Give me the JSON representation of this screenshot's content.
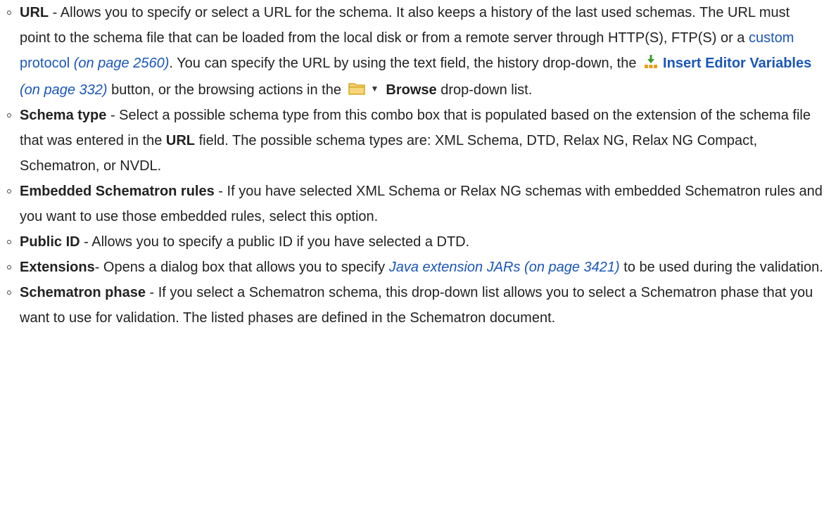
{
  "items": [
    {
      "term": "URL",
      "sep": " - ",
      "text1": "Allows you to specify or select a URL for the schema. It also keeps a history of the last used schemas. The URL must point to the schema file that can be loaded from the local disk or from a remote server through HTTP(S), FTP(S) or a ",
      "link1": "custom protocol",
      "ref1": " (on page 2560)",
      "text2": ". You can specify the URL by using the text field, the history drop-down, the ",
      "link2": "Insert Editor Variables",
      "ref2": " (on page 332)",
      "text3": " button, or the browsing actions in the ",
      "browse": "Browse",
      "text4": " drop-down list."
    },
    {
      "term": "Schema type",
      "sep": " - ",
      "text1": "Select a possible schema type from this combo box that is populated based on the extension of the schema file that was entered in the ",
      "bold2": "URL",
      "text2": " field. The possible schema types are: XML Schema, DTD, Relax NG, Relax NG Compact, Schematron, or NVDL."
    },
    {
      "term": "Embedded Schematron rules",
      "sep": " - ",
      "text1": "If you have selected XML Schema or Relax NG schemas with embedded Schematron rules and you want to use those embedded rules, select this option."
    },
    {
      "term": "Public ID",
      "sep": " - ",
      "text1": "Allows you to specify a public ID if you have selected a DTD."
    },
    {
      "term": "Extensions",
      "sep": "- ",
      "text1": "Opens a dialog box that allows you to specify ",
      "link1": "Java extension JARs (on page 3421)",
      "text2": " to be used during the validation."
    },
    {
      "term": "Schematron phase",
      "sep": " - ",
      "text1": "If you select a Schematron schema, this drop-down list allows you to select a Schematron phase that you want to use for validation. The listed phases are defined in the Schematron document."
    }
  ],
  "icons": {
    "insert_variables": "insert-editor-variables-icon",
    "browse_folder": "folder-icon",
    "browse_caret": "dropdown-caret-icon"
  },
  "colors": {
    "link": "#1a56b8",
    "text": "#222222",
    "folder": "#f5c542"
  }
}
